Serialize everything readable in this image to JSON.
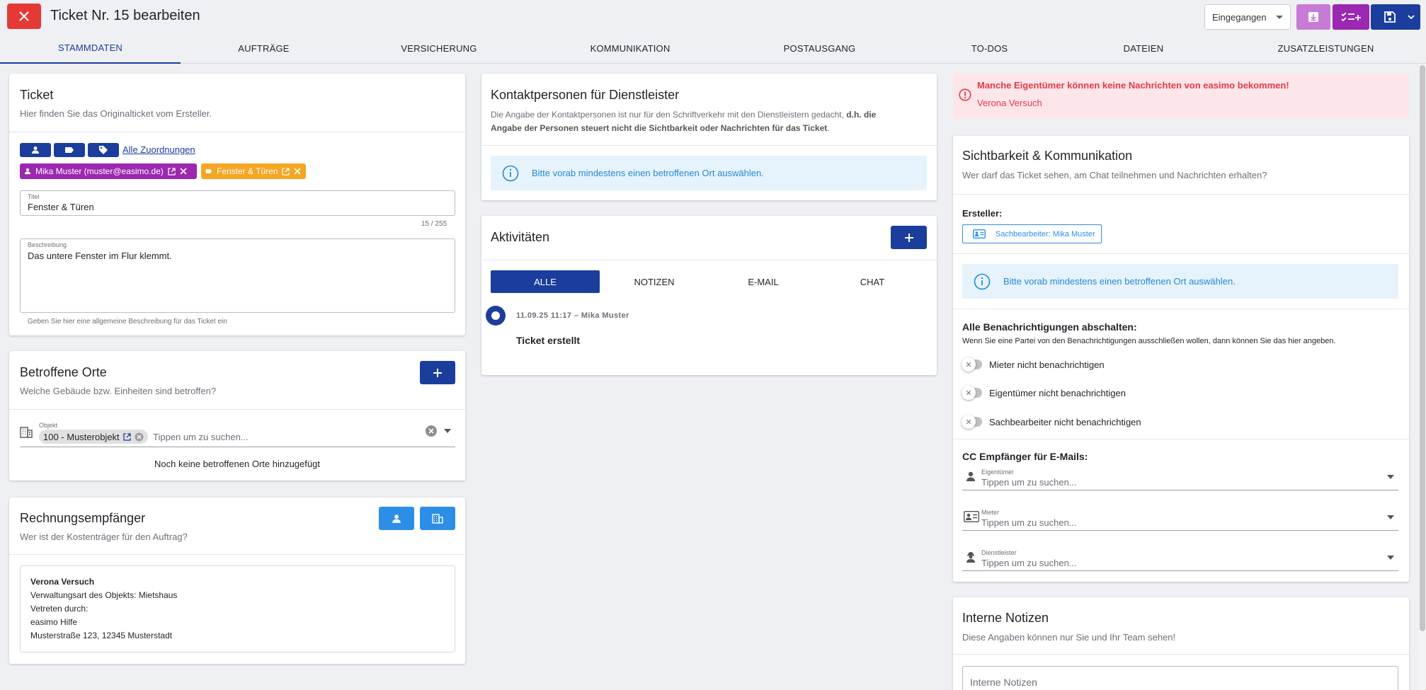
{
  "header": {
    "title": "Ticket Nr. 15 bearbeiten",
    "status_value": "Eingegangen"
  },
  "tabs": [
    "STAMMDATEN",
    "AUFTRÄGE",
    "VERSICHERUNG",
    "KOMMUNIKATION",
    "POSTAUSGANG",
    "TO-DOS",
    "DATEIEN",
    "ZUSATZLEISTUNGEN"
  ],
  "ticket": {
    "title": "Ticket",
    "subtitle": "Hier finden Sie das Originalticket vom Ersteller.",
    "all_assignments": "Alle Zuordnungen",
    "chip_person": "Mika Muster (muster@easimo.de)",
    "chip_category": "Fenster & Türen",
    "title_label": "Titel",
    "title_value": "Fenster & Türen",
    "title_counter": "15 / 255",
    "desc_label": "Beschreibung",
    "desc_value": "Das untere Fenster im Flur klemmt.",
    "desc_hint": "Geben Sie hier eine allgemeine Beschreibung für das Ticket ein"
  },
  "locations": {
    "title": "Betroffene Orte",
    "subtitle": "Welche Gebäude bzw. Einheiten sind betroffen?",
    "object_label": "Objekt",
    "object_chip": "100 - Musterobjekt",
    "search_placeholder": "Tippen um zu suchen...",
    "empty_text": "Noch keine betroffenen Orte hinzugefügt"
  },
  "invoice": {
    "title": "Rechnungsempfänger",
    "subtitle": "Wer ist der Kostenträger für den Auftrag?",
    "name": "Verona Versuch",
    "line1": "Verwaltungsart des Objekts: Mietshaus",
    "line2": "Vetreten durch:",
    "line3": "easimo Hilfe",
    "line4": "Musterstraße 123, 12345 Musterstadt"
  },
  "contacts": {
    "title": "Kontaktpersonen für Dienstleister",
    "desc_a": "Die Angabe der Kontaktpersonen ist nur für den Schriftverkehr mit den Dienstleistern gedacht,",
    "desc_b": "d.h. die",
    "desc_c": "Angabe der Personen steuert nicht die Sichtbarkeit oder Nachrichten für das Ticket",
    "desc_d": ".",
    "info": "Bitte vorab mindestens einen betroffenen Ort auswählen."
  },
  "activities": {
    "title": "Aktivitäten",
    "filters": [
      "ALLE",
      "NOTIZEN",
      "E-MAIL",
      "CHAT"
    ],
    "entry_meta": "11.09.25 11:17 – Mika Muster",
    "entry_text": "Ticket erstellt"
  },
  "alert": {
    "title": "Manche Eigentümer können keine Nachrichten von easimo bekommen!",
    "name": "Verona Versuch"
  },
  "visibility": {
    "title": "Sichtbarkeit & Kommunikation",
    "subtitle": "Wer darf das Ticket sehen, am Chat teilnehmen und Nachrichten erhalten?",
    "creator_label": "Ersteller:",
    "creator_chip": "Sachbearbeiter: Mika Muster",
    "info": "Bitte vorab mindestens einen betroffenen Ort auswählen.",
    "notif_title": "Alle Benachrichtigungen abschalten:",
    "notif_sub": "Wenn Sie eine Partei von den Benachrichtigungen ausschließen wollen, dann können Sie das hier angeben.",
    "toggles": [
      "Mieter nicht benachrichtigen",
      "Eigentümer nicht benachrichtigen",
      "Sachbearbeiter nicht benachrichtigen"
    ],
    "cc_title": "CC Empfänger für E-Mails:",
    "cc_fields": [
      {
        "label": "Eigentümer",
        "placeholder": "Tippen um zu suchen..."
      },
      {
        "label": "Mieter",
        "placeholder": "Tippen um zu suchen..."
      },
      {
        "label": "Dienstleister",
        "placeholder": "Tippen um zu suchen..."
      }
    ]
  },
  "notes": {
    "title": "Interne Notizen",
    "subtitle": "Diese Angaben können nur Sie und Ihr Team sehen!",
    "field_label": "Interne Notizen"
  },
  "colors": {
    "primary": "#1b3d9c",
    "danger": "#e53935",
    "purple": "#9c27b0",
    "purple_light": "#c77bd6",
    "orange": "#f5a623",
    "light_blue": "#2d8ee8"
  }
}
